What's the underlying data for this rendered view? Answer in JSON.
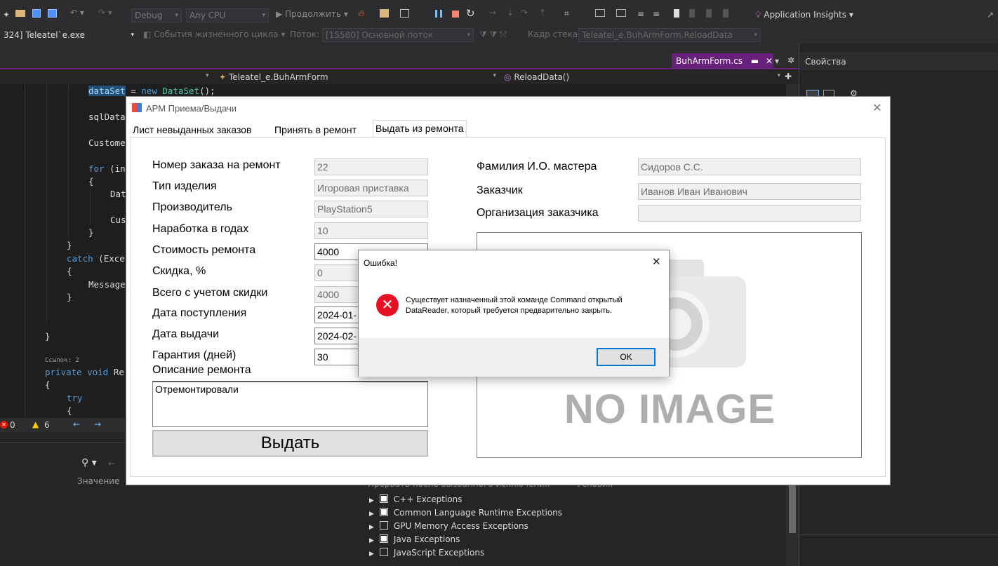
{
  "vs": {
    "toolbar": {
      "config": "Debug",
      "platform": "Any CPU",
      "continue_label": "Продолжить",
      "app_insights": "Application Insights"
    },
    "debug_bar": {
      "process": "324] Teleatel`e.exe",
      "lifecycle": "События жизненного цикла",
      "thread_label": "Поток:",
      "thread_value": "[15580] Основной поток",
      "stack_label": "Кадр стека:",
      "stack_value": "Teleatel_e.BuhArmForm.ReloadData"
    },
    "editor": {
      "tab_name": "BuhArmForm.cs",
      "class_nav": "Teleatel_e.BuhArmForm",
      "method_nav": "ReloadData()",
      "code": {
        "l1_var": "dataSet",
        "l1_rest": " = ",
        "l1_kw": "new",
        "l1_type": " DataSet",
        "l1_end": "();",
        "l2": "sqlData",
        "l3": "Custome",
        "l4_kw": "for",
        "l4_rest": " (in",
        "l5": "{",
        "l6": "Dat",
        "l7": "Cus",
        "l8": "}",
        "l9": "}",
        "l10_kw": "catch",
        "l10_rest": " (Exce",
        "l11": "{",
        "l12": "Message",
        "l13": "}",
        "l14": "}",
        "refs": "Ссылок: 2",
        "l15_kw": "private void",
        "l15_rest": " Re",
        "l16": "{",
        "l17_kw": "try",
        "l18": "{"
      },
      "errors_count": "0",
      "warnings_count": "6"
    },
    "properties": {
      "title": "Свойства"
    },
    "locals": {
      "value_header": "Значение"
    },
    "exceptions": {
      "header_col1": "Прервать после вызванного исключения",
      "header_col2": "Условия",
      "items": [
        {
          "label": "C++ Exceptions",
          "checked": true
        },
        {
          "label": "Common Language Runtime Exceptions",
          "checked": true
        },
        {
          "label": "GPU Memory Access Exceptions",
          "checked": false
        },
        {
          "label": "Java Exceptions",
          "checked": true
        },
        {
          "label": "JavaScript Exceptions",
          "checked": false
        }
      ]
    }
  },
  "form": {
    "title": "АРМ Приема/Выдачи",
    "tabs": [
      "Лист невыданных заказов",
      "Принять в ремонт",
      "Выдать из ремонта"
    ],
    "active_tab": 2,
    "fields": {
      "order_num": {
        "label": "Номер заказа на ремонт",
        "value": "22"
      },
      "product_type": {
        "label": "Тип изделия",
        "value": "Игоровая приставка"
      },
      "manufacturer": {
        "label": "Производитель",
        "value": "PlayStation5"
      },
      "runtime_years": {
        "label": "Наработка в годах",
        "value": "10"
      },
      "repair_cost": {
        "label": "Стоимость ремонта",
        "value": "4000"
      },
      "discount": {
        "label": "Скидка, %",
        "value": "0"
      },
      "total": {
        "label": "Всего с учетом скидки",
        "value": "4000"
      },
      "date_received": {
        "label": "Дата поступления",
        "value": "2024-01-"
      },
      "date_issued": {
        "label": "Дата выдачи",
        "value": "2024-02-"
      },
      "warranty": {
        "label": "Гарантия (дней)",
        "value": "30"
      },
      "master": {
        "label": "Фамилия И.О. мастера",
        "value": "Сидоров С.С."
      },
      "customer": {
        "label": "Заказчик",
        "value": "Иванов Иван Иванович"
      },
      "customer_org": {
        "label": "Организация заказчика",
        "value": ""
      }
    },
    "description_label": "Описание ремонта",
    "description_value": "Отремонтировали",
    "issue_button": "Выдать",
    "image_placeholder": "NO IMAGE"
  },
  "dialog": {
    "title": "Ошибка!",
    "message_line1": "Существует назначенный этой команде Command открытый",
    "message_line2": "DataReader, который требуется предварительно закрыть.",
    "ok_label": "OK"
  },
  "colors": {
    "vs_bg": "#1e1e1e",
    "vs_chrome": "#2d2d30",
    "vs_accent": "#68217a",
    "error_red": "#e81123"
  }
}
